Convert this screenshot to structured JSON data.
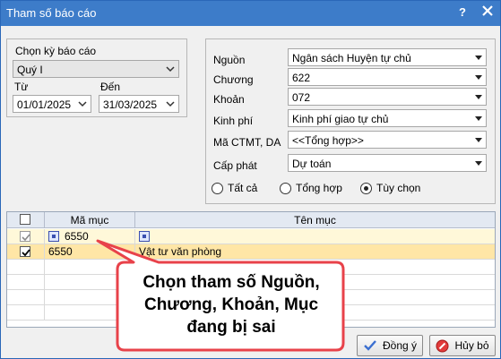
{
  "window": {
    "title": "Tham số báo cáo",
    "help_symbol": "?"
  },
  "period": {
    "group_label": "Chọn kỳ báo cáo",
    "selected": "Quý I",
    "from_label": "Từ",
    "from_value": "01/01/2025",
    "to_label": "Đến",
    "to_value": "31/03/2025"
  },
  "params": [
    {
      "label": "Nguồn",
      "value": "Ngân sách Huyện tự chủ"
    },
    {
      "label": "Chương",
      "value": "622"
    },
    {
      "label": "Khoản",
      "value": "072"
    },
    {
      "label": "Kinh phí",
      "value": "Kinh phí giao tự chủ"
    },
    {
      "label": "Mã CTMT, DA",
      "value": "<<Tổng hợp>>"
    },
    {
      "label": "Cấp phát",
      "value": "Dự toán"
    }
  ],
  "radios": [
    {
      "label": "Tất cả",
      "checked": false
    },
    {
      "label": "Tổng hợp",
      "checked": false
    },
    {
      "label": "Tùy chọn",
      "checked": true
    }
  ],
  "grid": {
    "columns": [
      "Mã mục",
      "Tên mục"
    ],
    "filter_code": "6550",
    "rows": [
      {
        "checked": true,
        "code": "6550",
        "name": "Vật tư văn phòng"
      }
    ]
  },
  "callout": {
    "lines": [
      "Chọn tham số Nguồn,",
      "Chương, Khoản, Mục",
      "đang bị sai"
    ],
    "color": "#e8424a"
  },
  "buttons": {
    "ok": "Đồng ý",
    "cancel": "Hủy bỏ"
  }
}
